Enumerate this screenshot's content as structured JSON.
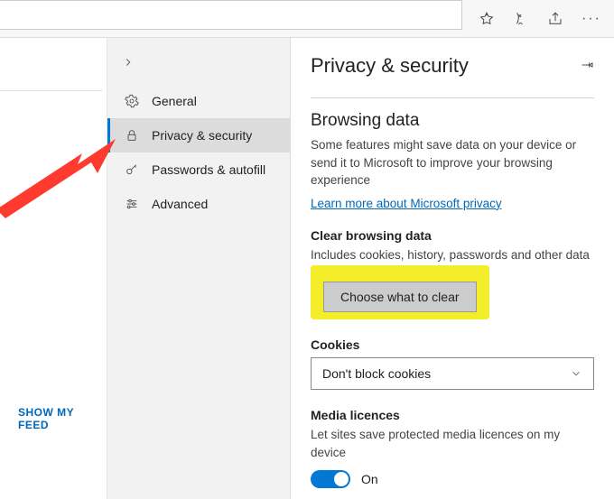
{
  "toolbar": {
    "icons": [
      "favorites-star-icon",
      "reading-list-icon",
      "share-icon",
      "more-icon"
    ]
  },
  "left": {
    "show_feed": "SHOW MY FEED"
  },
  "nav": {
    "items": [
      {
        "icon": "gear-icon",
        "label": "General"
      },
      {
        "icon": "lock-icon",
        "label": "Privacy & security",
        "active": true
      },
      {
        "icon": "key-icon",
        "label": "Passwords & autofill"
      },
      {
        "icon": "sliders-icon",
        "label": "Advanced"
      }
    ]
  },
  "content": {
    "title": "Privacy & security",
    "browsing": {
      "heading": "Browsing data",
      "desc": "Some features might save data on your device or send it to Microsoft to improve your browsing experience",
      "link": "Learn more about Microsoft privacy"
    },
    "clear": {
      "heading": "Clear browsing data",
      "desc": "Includes cookies, history, passwords and other data",
      "button": "Choose what to clear"
    },
    "cookies": {
      "heading": "Cookies",
      "selected": "Don't block cookies"
    },
    "media": {
      "heading": "Media licences",
      "desc": "Let sites save protected media licences on my device",
      "toggle_label": "On",
      "toggle_on": true
    }
  }
}
